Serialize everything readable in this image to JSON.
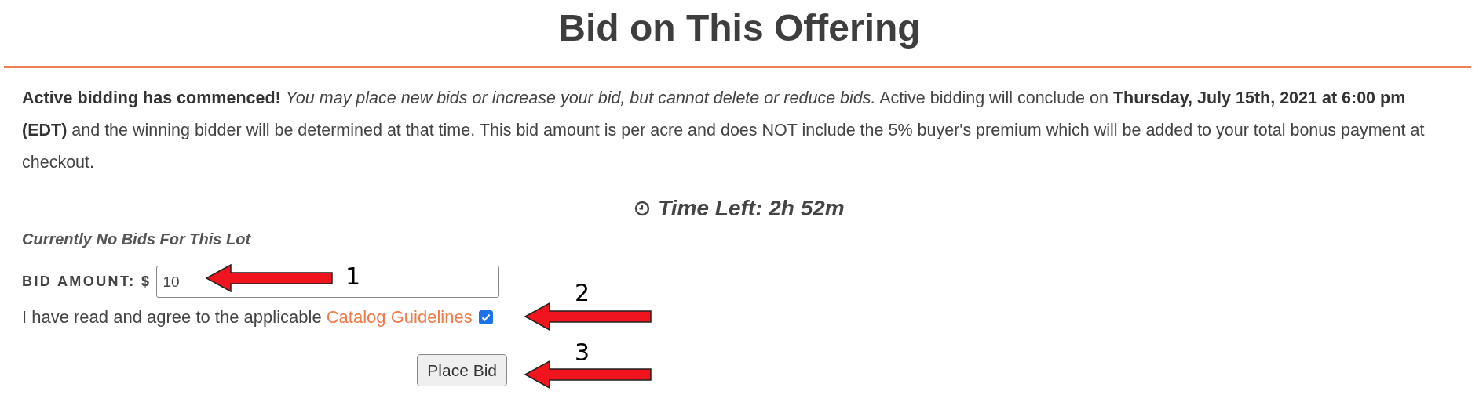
{
  "title": "Bid on This Offering",
  "notice": "**Active bidding has commenced!** *You may place new bids or increase your bid, but cannot delete or reduce bids.* Active bidding will conclude on **Thursday, July 15th, 2021 at 6:00 pm (EDT)** and the winning bidder will be determined at that time. This bid amount is per acre and does NOT include the 5% buyer's premium which will be added to your total bonus payment at checkout.",
  "time_left": "Time Left: 2h 52m",
  "bid_status": "Currently No Bids For This Lot",
  "bid_form": {
    "label": "BID AMOUNT: $",
    "value": "10",
    "agreement": "I have read and agree to the applicable",
    "link": "Catalog Guidelines",
    "checked": true,
    "button": "Place Bid"
  },
  "annotations": [
    {
      "label": "1"
    },
    {
      "label": "2"
    },
    {
      "label": "3"
    }
  ]
}
